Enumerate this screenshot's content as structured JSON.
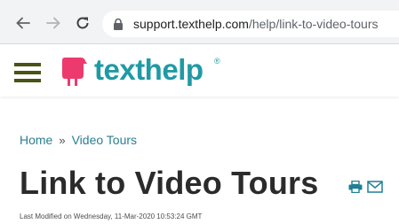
{
  "browser": {
    "url_domain": "support.texthelp.com",
    "url_path": "/help/link-to-video-tours",
    "icons": [
      "back-arrow-icon",
      "forward-arrow-icon",
      "reload-icon",
      "lock-icon"
    ]
  },
  "header": {
    "logo_text": "texthelp",
    "logo_registered": "®",
    "brand_color": "#1f9aa5",
    "logo_mark_color": "#ec3a6e",
    "menu_icon": "hamburger-menu-icon"
  },
  "breadcrumb": {
    "home": "Home",
    "separator": "»",
    "current": "Video Tours"
  },
  "article": {
    "title": "Link to Video Tours",
    "last_modified": "Last Modified on Wednesday, 11-Mar-2020 10:53:24 GMT",
    "action_icons": [
      "print-icon",
      "email-icon"
    ],
    "icon_color": "#1f7f95"
  }
}
